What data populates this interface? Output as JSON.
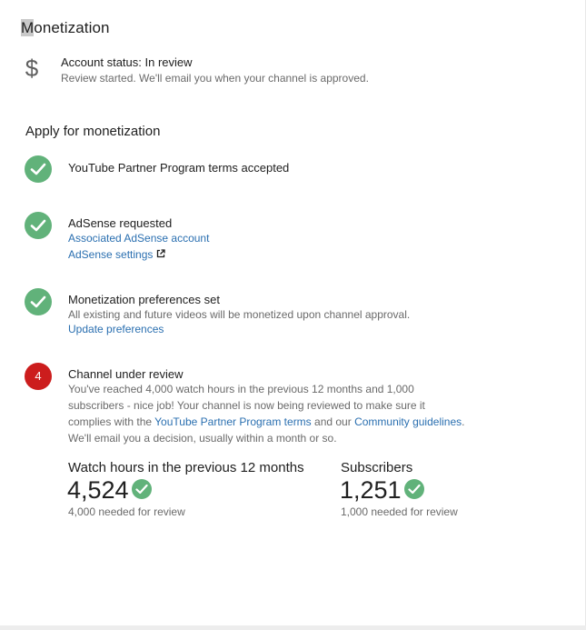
{
  "page": {
    "title_first_letter": "M",
    "title_rest": "onetization"
  },
  "account_status": {
    "icon": "dollar-icon",
    "icon_glyph": "$",
    "title": "Account status: In review",
    "subtitle": "Review started. We'll email you when your channel is approved."
  },
  "apply": {
    "title": "Apply for monetization",
    "steps": [
      {
        "status": "done",
        "title": "YouTube Partner Program terms accepted"
      },
      {
        "status": "done",
        "title": "AdSense requested",
        "link_account": "Associated AdSense account",
        "link_settings": "AdSense settings"
      },
      {
        "status": "done",
        "title": "Monetization preferences set",
        "description": "All existing and future videos will be monetized upon channel approval.",
        "link_update": "Update preferences"
      },
      {
        "status": "pending",
        "number": "4",
        "title": "Channel under review",
        "desc_line1": "You've reached 4,000 watch hours in the previous 12 months and 1,000",
        "desc_line2": "subscribers - nice job! Your channel is now being reviewed to make sure it",
        "desc_line3_prefix": "complies with the ",
        "desc_line3_link1": "YouTube Partner Program terms",
        "desc_line3_mid": " and our ",
        "desc_line3_link2": "Community guidelines",
        "desc_line3_suffix": ".",
        "desc_line4": "We'll email you a decision, usually within a month or so."
      }
    ]
  },
  "stats": {
    "watch_hours": {
      "label": "Watch hours in the previous 12 months",
      "value": "4,524",
      "note": "4,000 needed for review"
    },
    "subscribers": {
      "label": "Subscribers",
      "value": "1,251",
      "note": "1,000 needed for review"
    }
  },
  "colors": {
    "success": "#61b27a",
    "pending": "#cc1d1d",
    "link": "#2a6fb0"
  }
}
